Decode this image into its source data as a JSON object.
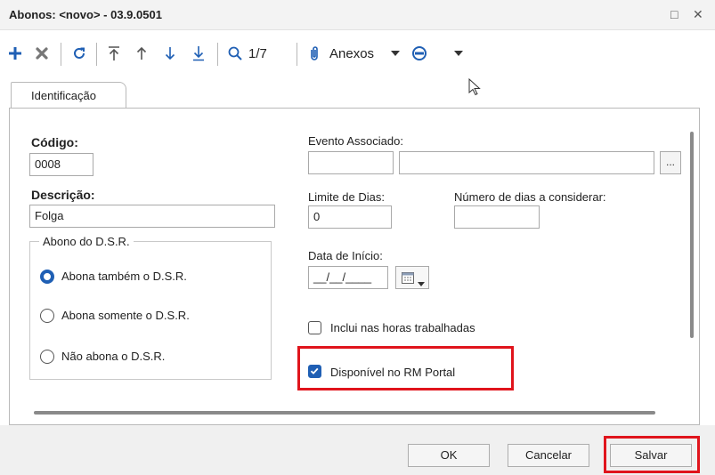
{
  "window": {
    "title": "Abonos: <novo> - 03.9.0501",
    "maximize_icon": "□",
    "close_icon": "✕"
  },
  "toolbar": {
    "icons": [
      "add-icon",
      "delete-icon",
      "refresh-icon",
      "first-record-icon",
      "previous-record-icon",
      "next-record-icon",
      "last-record-icon",
      "search-icon",
      "paperclip-icon",
      "chevron-down-icon",
      "options-icon",
      "chevron-down-icon"
    ],
    "record_counter": "1/7",
    "attachments_label": "Anexos",
    "colors": {
      "add": "#1f5fb4",
      "icon": "#555555",
      "accent": "#1f5fb4"
    }
  },
  "tabs": [
    {
      "label": "Identificação",
      "active": true
    }
  ],
  "form": {
    "codigo": {
      "label": "Código:",
      "value": "0008"
    },
    "descricao": {
      "label": "Descrição:",
      "value": "Folga"
    },
    "abono_dsr": {
      "title": "Abono do D.S.R.",
      "options": [
        {
          "label": "Abona também o D.S.R.",
          "checked": true
        },
        {
          "label": "Abona somente o D.S.R.",
          "checked": false
        },
        {
          "label": "Não abona o D.S.R.",
          "checked": false
        }
      ]
    },
    "evento_associado": {
      "label": "Evento Associado:",
      "code": "",
      "description": "",
      "lookup_button": "..."
    },
    "limite_dias": {
      "label": "Limite de Dias:",
      "value": "0"
    },
    "numero_dias": {
      "label": "Número de dias a considerar:",
      "value": ""
    },
    "data_inicio": {
      "label": "Data de Início:",
      "value": "__/__/____"
    },
    "inclui_horas": {
      "label": "Inclui nas horas trabalhadas",
      "checked": false
    },
    "disponivel_portal": {
      "label": "Disponível no RM Portal",
      "checked": true
    }
  },
  "highlight_color": "#e0141c",
  "footer": {
    "ok_label": "OK",
    "cancel_label": "Cancelar",
    "save_label": "Salvar"
  }
}
